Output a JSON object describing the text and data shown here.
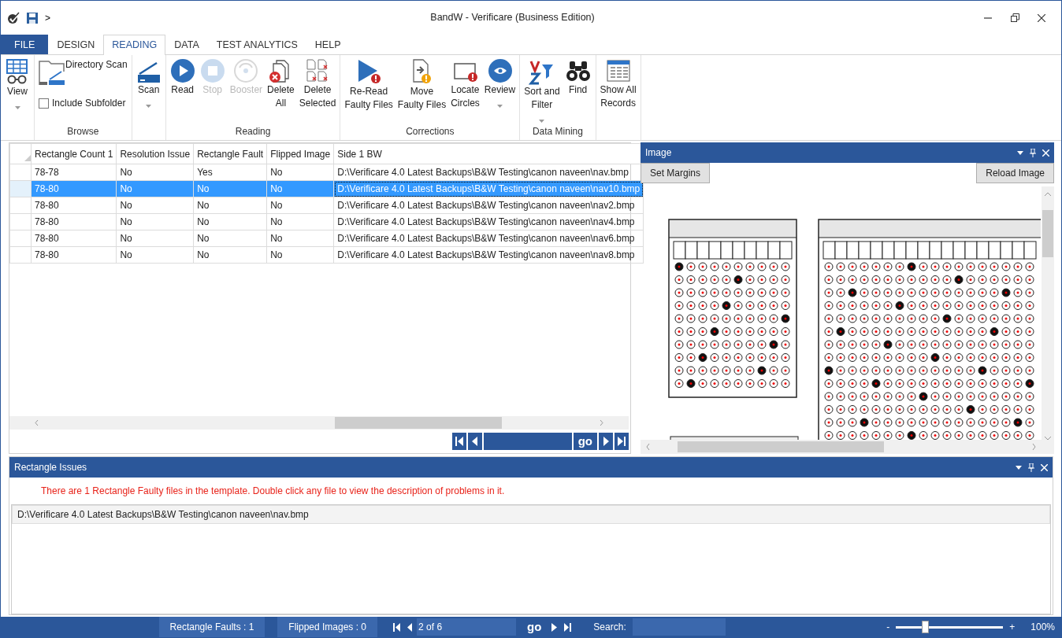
{
  "window": {
    "title": "BandW - Verificare (Business Edition)",
    "quick_access_more": ">"
  },
  "tabs": [
    {
      "label": "FILE",
      "kind": "file",
      "selected": false
    },
    {
      "label": "DESIGN",
      "kind": "tab",
      "selected": false
    },
    {
      "label": "READING",
      "kind": "tab",
      "selected": true
    },
    {
      "label": "DATA",
      "kind": "tab",
      "selected": false
    },
    {
      "label": "TEST ANALYTICS",
      "kind": "tab",
      "selected": false
    },
    {
      "label": "HELP",
      "kind": "tab",
      "selected": false
    }
  ],
  "ribbon": {
    "groups": [
      {
        "items": [
          {
            "kind": "large",
            "label": "View",
            "dropdown": true,
            "disabled": false
          }
        ]
      },
      {
        "label": "Browse",
        "items": [
          {
            "kind": "wide",
            "label": "Directory Scan",
            "dropdown": false,
            "disabled": false
          },
          {
            "kind": "checkbox",
            "label": "Include Subfolder",
            "checked": false
          }
        ]
      },
      {
        "items": [
          {
            "kind": "large",
            "label": "Scan",
            "dropdown": true,
            "disabled": false
          }
        ]
      },
      {
        "label": "Reading",
        "items": [
          {
            "kind": "large",
            "label": "Read",
            "dropdown": false,
            "disabled": false
          },
          {
            "kind": "large",
            "label": "Stop",
            "dropdown": false,
            "disabled": true
          },
          {
            "kind": "large",
            "label": "Booster",
            "dropdown": false,
            "disabled": true
          },
          {
            "kind": "large",
            "label": "Delete\nAll",
            "dropdown": false,
            "disabled": false
          },
          {
            "kind": "large",
            "label": "Delete\nSelected",
            "dropdown": false,
            "disabled": false
          }
        ]
      },
      {
        "label": "Corrections",
        "items": [
          {
            "kind": "large",
            "label": "Re-Read\nFaulty Files",
            "dropdown": false,
            "disabled": false
          },
          {
            "kind": "large",
            "label": "Move\nFaulty Files",
            "dropdown": false,
            "disabled": false
          },
          {
            "kind": "large",
            "label": "Locate\nCircles",
            "dropdown": false,
            "disabled": false
          },
          {
            "kind": "large",
            "label": "Review",
            "dropdown": true,
            "disabled": false
          }
        ]
      },
      {
        "label": "Data Mining",
        "items": [
          {
            "kind": "large",
            "label": "Sort and\nFilter",
            "dropdown": true,
            "disabled": false
          },
          {
            "kind": "large",
            "label": "Find",
            "dropdown": false,
            "disabled": false
          }
        ]
      },
      {
        "items": [
          {
            "kind": "large",
            "label": "Show All\nRecords",
            "dropdown": false,
            "disabled": false
          }
        ]
      }
    ]
  },
  "grid": {
    "columns": [
      "Rectangle Count 1",
      "Resolution Issue",
      "Rectangle Fault",
      "Flipped Image",
      "Side 1 BW"
    ],
    "rows": [
      {
        "cells": [
          "78-78",
          "No",
          "Yes",
          "No",
          "D:\\Verificare 4.0 Latest Backups\\B&W Testing\\canon naveen\\nav.bmp"
        ],
        "selected": false
      },
      {
        "cells": [
          "78-80",
          "No",
          "No",
          "No",
          "D:\\Verificare 4.0 Latest Backups\\B&W Testing\\canon naveen\\nav10.bmp"
        ],
        "selected": true
      },
      {
        "cells": [
          "78-80",
          "No",
          "No",
          "No",
          "D:\\Verificare 4.0 Latest Backups\\B&W Testing\\canon naveen\\nav2.bmp"
        ],
        "selected": false
      },
      {
        "cells": [
          "78-80",
          "No",
          "No",
          "No",
          "D:\\Verificare 4.0 Latest Backups\\B&W Testing\\canon naveen\\nav4.bmp"
        ],
        "selected": false
      },
      {
        "cells": [
          "78-80",
          "No",
          "No",
          "No",
          "D:\\Verificare 4.0 Latest Backups\\B&W Testing\\canon naveen\\nav6.bmp"
        ],
        "selected": false
      },
      {
        "cells": [
          "78-80",
          "No",
          "No",
          "No",
          "D:\\Verificare 4.0 Latest Backups\\B&W Testing\\canon naveen\\nav8.bmp"
        ],
        "selected": false
      }
    ],
    "pager": {
      "go": "go"
    }
  },
  "image_panel": {
    "title": "Image",
    "buttons": [
      "Set Margins",
      "Reload Image"
    ]
  },
  "issues_panel": {
    "title": "Rectangle Issues",
    "message": "There are 1 Rectangle Faulty files in the template. Double click any file to view the description of problems in it.",
    "files": [
      "D:\\Verificare 4.0 Latest Backups\\B&W Testing\\canon naveen\\nav.bmp"
    ]
  },
  "status_bar": {
    "rectangle_faults": "Rectangle Faults : 1",
    "flipped_images": "Flipped Images : 0",
    "page": "2 of 6",
    "go": "go",
    "search_label": "Search:",
    "zoom_minus": "-",
    "zoom_plus": "+",
    "zoom": {
      "level": 0.27
    },
    "zoom_reading": "100%"
  }
}
